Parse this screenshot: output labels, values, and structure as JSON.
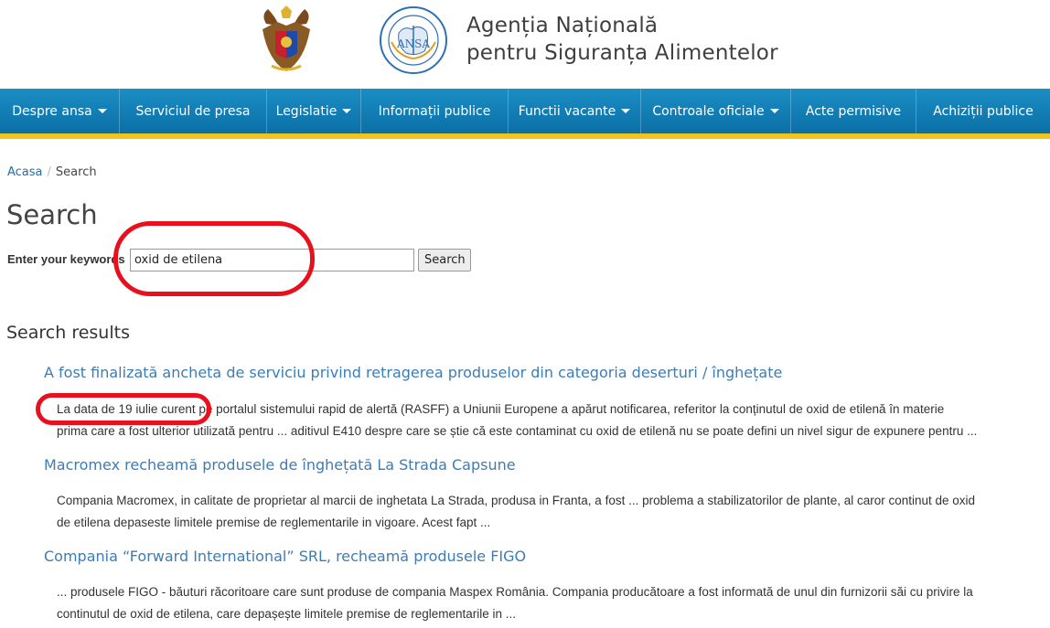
{
  "header": {
    "agency_line1": "Agenția Națională",
    "agency_line2": "pentru Siguranța Alimentelor",
    "seal_text": "ANSA"
  },
  "nav": {
    "items": [
      {
        "label": "Despre ansa",
        "has_dropdown": true
      },
      {
        "label": "Serviciul de presa",
        "has_dropdown": false
      },
      {
        "label": "Legislatie",
        "has_dropdown": true
      },
      {
        "label": "Informații publice",
        "has_dropdown": false
      },
      {
        "label": "Functii vacante",
        "has_dropdown": true
      },
      {
        "label": "Controale oficiale",
        "has_dropdown": true
      },
      {
        "label": "Acte permisive",
        "has_dropdown": false
      },
      {
        "label": "Achiziții publice",
        "has_dropdown": false
      }
    ]
  },
  "breadcrumb": {
    "home": "Acasa",
    "separator": "/",
    "current": "Search"
  },
  "page_title": "Search",
  "search": {
    "label": "Enter your keywords",
    "value": "oxid de etilena",
    "button": "Search"
  },
  "results_title": "Search results",
  "results": [
    {
      "title": "A fost finalizată ancheta de serviciu privind retragerea produselor din categoria deserturi / înghețate",
      "snippet_line1": "La data de 19 iulie curent pe portalul sistemului rapid de alertă (RASFF) a  Uniunii Europene a apărut notificarea, referitor la conținutul de oxid de etilenă în materie",
      "snippet_line2": "prima care a fost ulterior utilizată pentru ... aditivul E410 despre care se știe că este contaminat cu oxid de etilenă nu se poate defini un nivel sigur de expunere pentru ..."
    },
    {
      "title": "Macromex recheamă produsele de înghețată La Strada Capsune",
      "snippet_line1": "Compania Macromex, in calitate de proprietar al marcii de inghetata La Strada, produsa in Franta, a fost ... problema a stabilizatorilor de plante, al caror continut de oxid",
      "snippet_line2": "de etilena depaseste limitele premise de reglementarile in vigoare. Acest fapt ..."
    },
    {
      "title": "Compania “Forward International” SRL, recheamă produsele FIGO",
      "snippet_line1": "... produsele FIGO - băuturi răcoritoare care sunt produse de compania Maspex România. Compania producătoare a fost informată de unul din furnizorii săi cu privire la",
      "snippet_line2": "continutul de oxid de etilena, care depașește limitele premise de reglementarile in ..."
    }
  ],
  "colors": {
    "nav_blue": "#1583bb",
    "nav_accent": "#f2c31a",
    "link": "#3d7cb4",
    "annotation_red": "#e8101c"
  }
}
